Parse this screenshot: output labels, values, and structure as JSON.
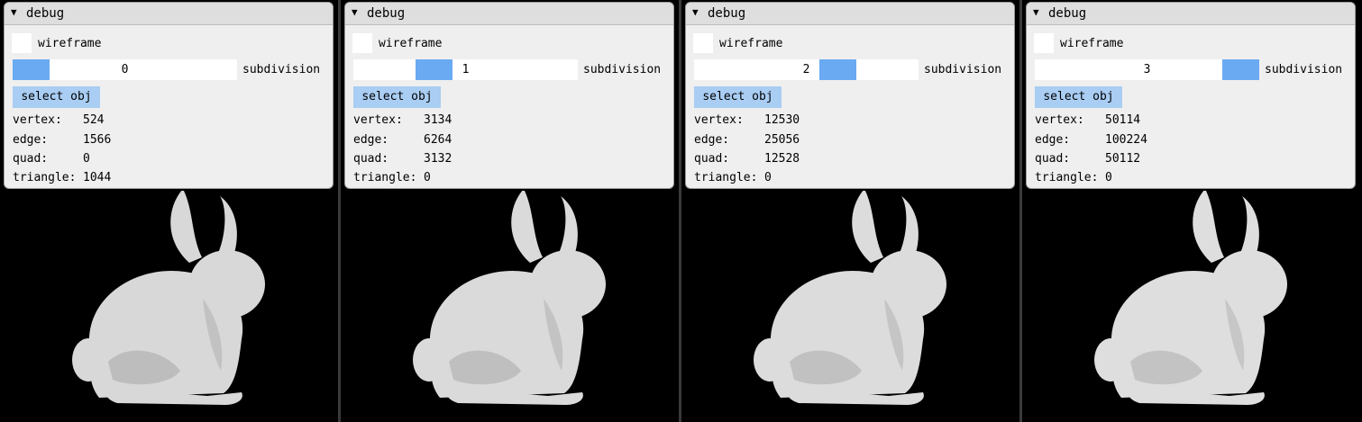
{
  "panes": [
    {
      "panel_title": "debug",
      "wireframe_label": "wireframe",
      "subdivision_label": "subdivision",
      "subdivision_value": "0",
      "subdivision_level": 0,
      "subdivision_max": 3,
      "select_button_label": "select obj",
      "stats": [
        {
          "label": "vertex:",
          "value": "524"
        },
        {
          "label": "edge:",
          "value": "1566"
        },
        {
          "label": "quad:",
          "value": "0"
        },
        {
          "label": "triangle:",
          "value": "1044"
        }
      ],
      "bunny_color": "#d8d8d8"
    },
    {
      "panel_title": "debug",
      "wireframe_label": "wireframe",
      "subdivision_label": "subdivision",
      "subdivision_value": "1",
      "subdivision_level": 1,
      "subdivision_max": 3,
      "select_button_label": "select obj",
      "stats": [
        {
          "label": "vertex:",
          "value": "3134"
        },
        {
          "label": "edge:",
          "value": "6264"
        },
        {
          "label": "quad:",
          "value": "3132"
        },
        {
          "label": "triangle:",
          "value": "0"
        }
      ],
      "bunny_color": "#dadada"
    },
    {
      "panel_title": "debug",
      "wireframe_label": "wireframe",
      "subdivision_label": "subdivision",
      "subdivision_value": "2",
      "subdivision_level": 2,
      "subdivision_max": 3,
      "select_button_label": "select obj",
      "stats": [
        {
          "label": "vertex:",
          "value": "12530"
        },
        {
          "label": "edge:",
          "value": "25056"
        },
        {
          "label": "quad:",
          "value": "12528"
        },
        {
          "label": "triangle:",
          "value": "0"
        }
      ],
      "bunny_color": "#dcdcdc"
    },
    {
      "panel_title": "debug",
      "wireframe_label": "wireframe",
      "subdivision_label": "subdivision",
      "subdivision_value": "3",
      "subdivision_level": 3,
      "subdivision_max": 3,
      "select_button_label": "select obj",
      "stats": [
        {
          "label": "vertex:",
          "value": "50114"
        },
        {
          "label": "edge:",
          "value": "100224"
        },
        {
          "label": "quad:",
          "value": "50112"
        },
        {
          "label": "triangle:",
          "value": "0"
        }
      ],
      "bunny_color": "#dedede"
    }
  ],
  "colors": {
    "slider_grab": "#6aaaf2",
    "button_bg": "#a9cdf3",
    "panel_bg": "#efefef",
    "viewport_bg": "#000000"
  },
  "icons": {
    "collapse": "triangle-down-icon"
  }
}
